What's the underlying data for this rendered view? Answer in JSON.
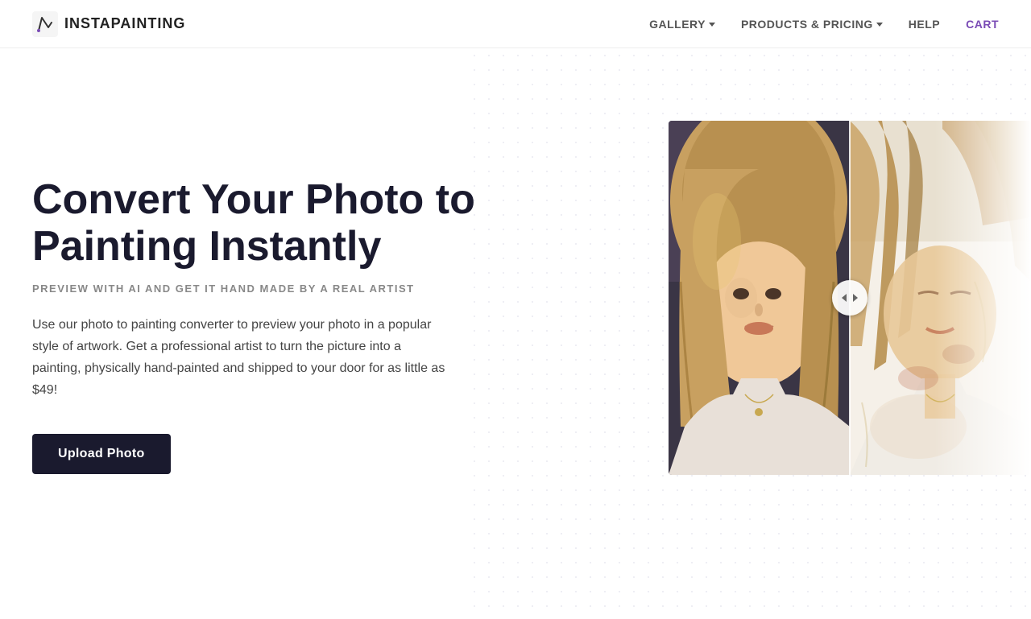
{
  "nav": {
    "logo_text": "INSTAPAINTING",
    "links": [
      {
        "label": "GALLERY",
        "has_dropdown": true,
        "id": "gallery"
      },
      {
        "label": "PRODUCTS & PRICING",
        "has_dropdown": true,
        "id": "products-pricing"
      },
      {
        "label": "HELP",
        "has_dropdown": false,
        "id": "help"
      },
      {
        "label": "CART",
        "has_dropdown": false,
        "id": "cart"
      }
    ]
  },
  "hero": {
    "title": "Convert Your Photo to Painting Instantly",
    "subtitle": "PREVIEW WITH AI AND GET IT HAND MADE BY A REAL ARTIST",
    "description": "Use our photo to painting converter to preview your photo in a popular style of artwork. Get a professional artist to turn the picture into a painting, physically hand-painted and shipped to your door for as little as $49!",
    "cta_label": "Upload Photo"
  },
  "colors": {
    "primary": "#1a1a2e",
    "accent": "#7a4bb5",
    "text_dark": "#1a1a2e",
    "text_medium": "#444444",
    "text_light": "#888888",
    "nav_link": "#555555"
  }
}
